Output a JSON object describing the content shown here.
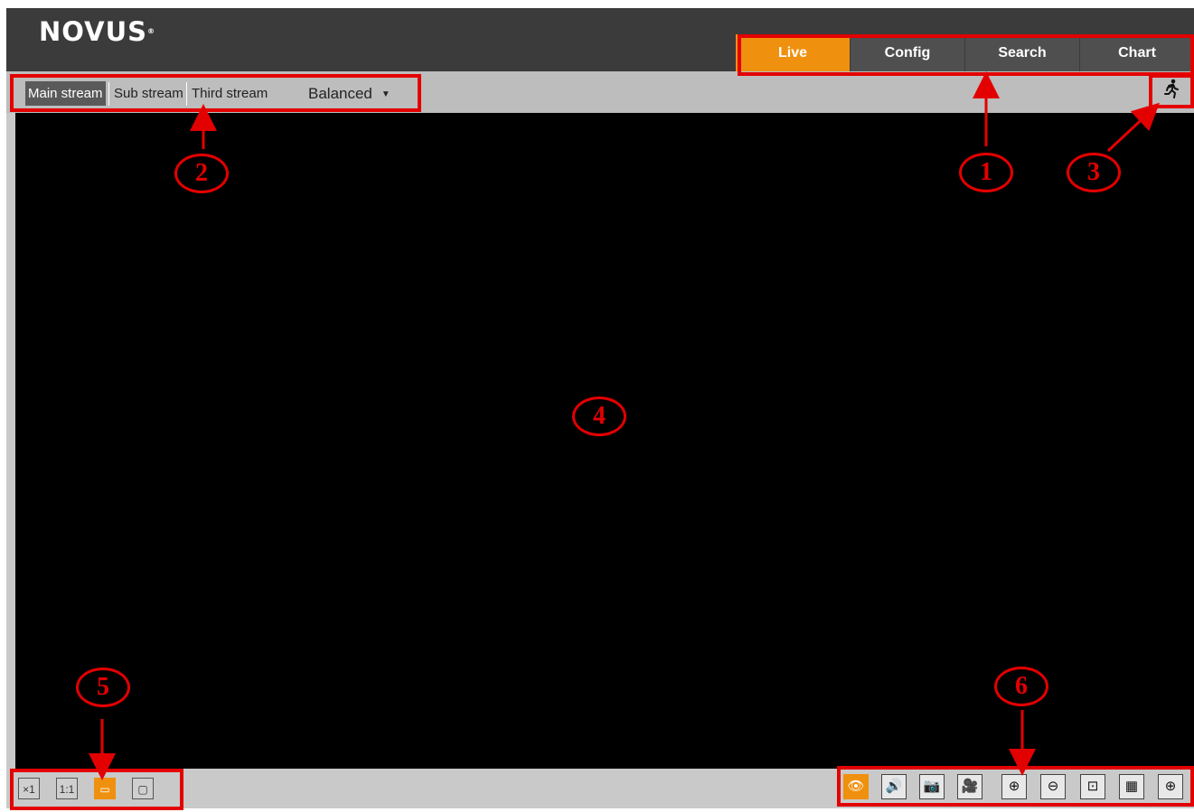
{
  "brand": {
    "logo_text": "NOVUS",
    "registered": "®"
  },
  "nav": {
    "tabs": [
      {
        "label": "Live",
        "active": true
      },
      {
        "label": "Config",
        "active": false
      },
      {
        "label": "Search",
        "active": false
      },
      {
        "label": "Chart",
        "active": false
      }
    ]
  },
  "streams": {
    "main": "Main stream",
    "sub": "Sub stream",
    "third": "Third stream",
    "quality": "Balanced",
    "selected": "Main stream"
  },
  "icons": {
    "motion": "running-person-icon",
    "caret": "caret-down-icon"
  },
  "view_controls": [
    {
      "icon": "original-size-icon",
      "glyph": "×1"
    },
    {
      "icon": "fit-window-icon",
      "glyph": "1:1"
    },
    {
      "icon": "stretch-icon",
      "glyph": "▭",
      "active": true
    },
    {
      "icon": "fullscreen-icon",
      "glyph": "▢"
    }
  ],
  "tools": [
    {
      "icon": "live-view-icon",
      "glyph": "👁",
      "active": true
    },
    {
      "icon": "audio-icon",
      "glyph": "🔊"
    },
    {
      "icon": "snapshot-icon",
      "glyph": "📷"
    },
    {
      "icon": "record-icon",
      "glyph": "🎥"
    },
    {
      "icon": "zoom-in-icon",
      "glyph": "⊕"
    },
    {
      "icon": "zoom-out-icon",
      "glyph": "⊖"
    },
    {
      "icon": "area-zoom-icon",
      "glyph": "⊡"
    },
    {
      "icon": "film-icon",
      "glyph": "▦"
    },
    {
      "icon": "ptz-icon",
      "glyph": "⊕"
    }
  ],
  "callouts": [
    "1",
    "2",
    "3",
    "4",
    "5",
    "6"
  ],
  "colors": {
    "accent": "#f0900f",
    "annotation": "#e30000",
    "header": "#3b3b3b"
  }
}
